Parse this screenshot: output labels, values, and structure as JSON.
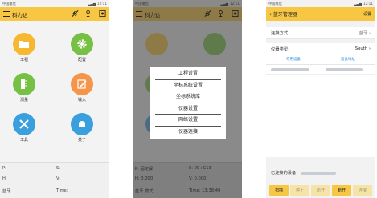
{
  "screen1": {
    "status": {
      "carrier": "中国电信",
      "time": "12:11"
    },
    "title": "科力达",
    "tiles": [
      {
        "label": "工程",
        "icon": "folder-icon",
        "color": "#f6b830"
      },
      {
        "label": "配置",
        "icon": "gear-icon",
        "color": "#76c043"
      },
      {
        "label": "测量",
        "icon": "measure-icon",
        "color": "#76c043"
      },
      {
        "label": "输入",
        "icon": "edit-icon",
        "color": "#f6954a"
      },
      {
        "label": "工具",
        "icon": "tools-icon",
        "color": "#3aa0dd"
      },
      {
        "label": "关于",
        "icon": "about-icon",
        "color": "#3aa0dd"
      }
    ],
    "info": {
      "p": "P:",
      "s": "S:",
      "h": "H:",
      "v": "V:",
      "mode": "蓝牙",
      "time": "Time:"
    }
  },
  "screen2": {
    "status": {
      "carrier": "中国电信",
      "time": "12:11"
    },
    "title": "科力达",
    "menu": [
      "工程设置",
      "坐标系统设置",
      "坐标系统库",
      "仪器设置",
      "网络设置",
      "仪器连接"
    ],
    "info": {
      "p": "P: 固定解",
      "s": "S: 09+C13",
      "h": "H: 0.000",
      "v": "V: 0.000",
      "mode": "蓝牙 模式",
      "time": "Time: 13:38:40"
    }
  },
  "screen3": {
    "status": {
      "carrier": "中国电信",
      "time": "12:11"
    },
    "title": "蓝牙管理器",
    "settings": "设置",
    "connection_label": "连接方式",
    "connection_value": "蓝牙",
    "instrument_label": "仪器类型:",
    "instrument_value": "South",
    "col_available": "可用设备",
    "col_address": "设备地址",
    "connected_label": "已连接的设备",
    "buttons": [
      "扫描",
      "停止",
      "断开",
      "断开",
      "连接"
    ]
  }
}
